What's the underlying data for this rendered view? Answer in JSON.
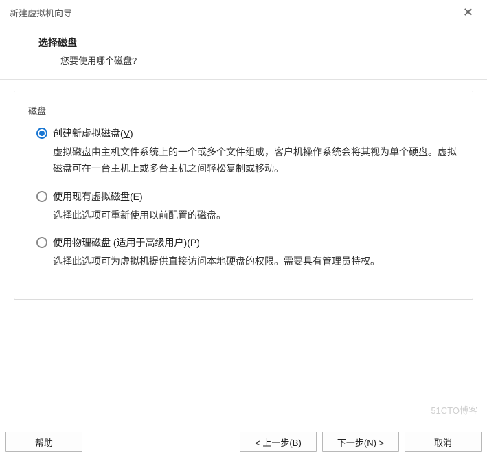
{
  "titlebar": {
    "title": "新建虚拟机向导"
  },
  "header": {
    "title": "选择磁盘",
    "subtitle": "您要使用哪个磁盘?"
  },
  "panel": {
    "title": "磁盘",
    "options": [
      {
        "label_pre": "创建新虚拟磁盘(",
        "label_key": "V",
        "label_post": ")",
        "description": "虚拟磁盘由主机文件系统上的一个或多个文件组成，客户机操作系统会将其视为单个硬盘。虚拟磁盘可在一台主机上或多台主机之间轻松复制或移动。",
        "selected": true
      },
      {
        "label_pre": "使用现有虚拟磁盘(",
        "label_key": "E",
        "label_post": ")",
        "description": "选择此选项可重新使用以前配置的磁盘。",
        "selected": false
      },
      {
        "label_pre": "使用物理磁盘 (适用于高级用户)(",
        "label_key": "P",
        "label_post": ")",
        "description": "选择此选项可为虚拟机提供直接访问本地硬盘的权限。需要具有管理员特权。",
        "selected": false
      }
    ]
  },
  "footer": {
    "help": "帮助",
    "back_pre": "< 上一步(",
    "back_key": "B",
    "back_post": ")",
    "next_pre": "下一步(",
    "next_key": "N",
    "next_post": ") >",
    "cancel": "取消"
  },
  "watermark": "51CTO博客"
}
